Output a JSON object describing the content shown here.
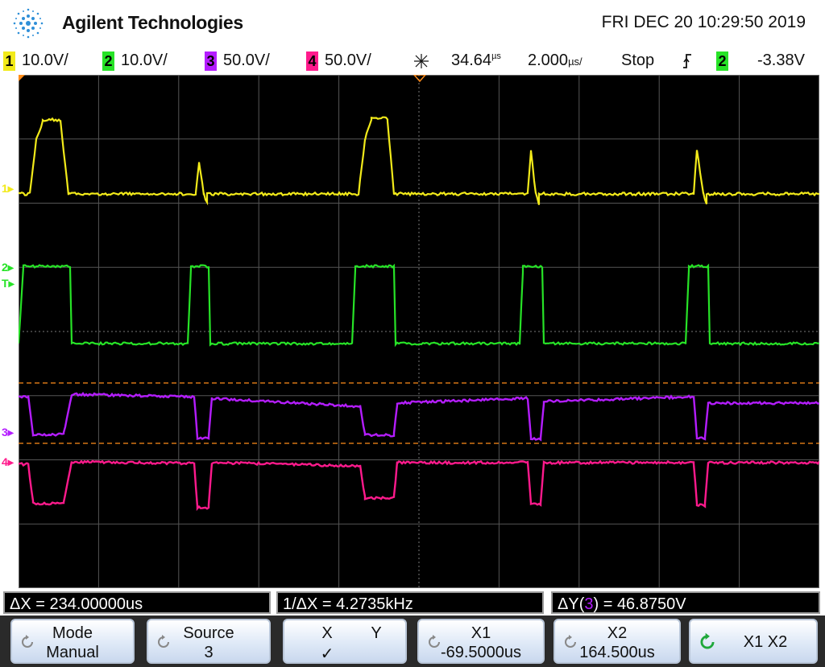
{
  "header": {
    "brand": "Agilent Technologies",
    "datetime": "FRI DEC 20 10:29:50 2019"
  },
  "status": {
    "ch1": {
      "num": "1",
      "scale": "10.0V/",
      "color": "#f2ea1a"
    },
    "ch2": {
      "num": "2",
      "scale": "10.0V/",
      "color": "#27e327"
    },
    "ch3": {
      "num": "3",
      "scale": "50.0V/",
      "color": "#b41dff"
    },
    "ch4": {
      "num": "4",
      "scale": "50.0V/",
      "color": "#ff1a8c"
    },
    "delay": "34.64",
    "delay_unit": "µs",
    "timebase": "2.000",
    "timebase_unit": "µs/",
    "run_state": "Stop",
    "trigger_source": "2",
    "trigger_level": "-3.38V"
  },
  "markers": {
    "ch1": "1",
    "ch2": "2",
    "trigger": "T",
    "ch3": "3",
    "ch4": "4"
  },
  "measurements": {
    "dx": "ΔX = 234.00000us",
    "inv_dx": "1/ΔX = 4.2735kHz",
    "dy_prefix": "ΔY(",
    "dy_source": "3",
    "dy_suffix": ") = 46.8750V"
  },
  "softkeys": {
    "mode_label": "Mode",
    "mode_value": "Manual",
    "source_label": "Source",
    "source_value": "3",
    "x_label": "X",
    "y_label": "Y",
    "x_check": "✓",
    "x1_label": "X1",
    "x1_value": "-69.5000us",
    "x2_label": "X2",
    "x2_value": "164.500us",
    "x1x2_label": "X1 X2"
  }
}
